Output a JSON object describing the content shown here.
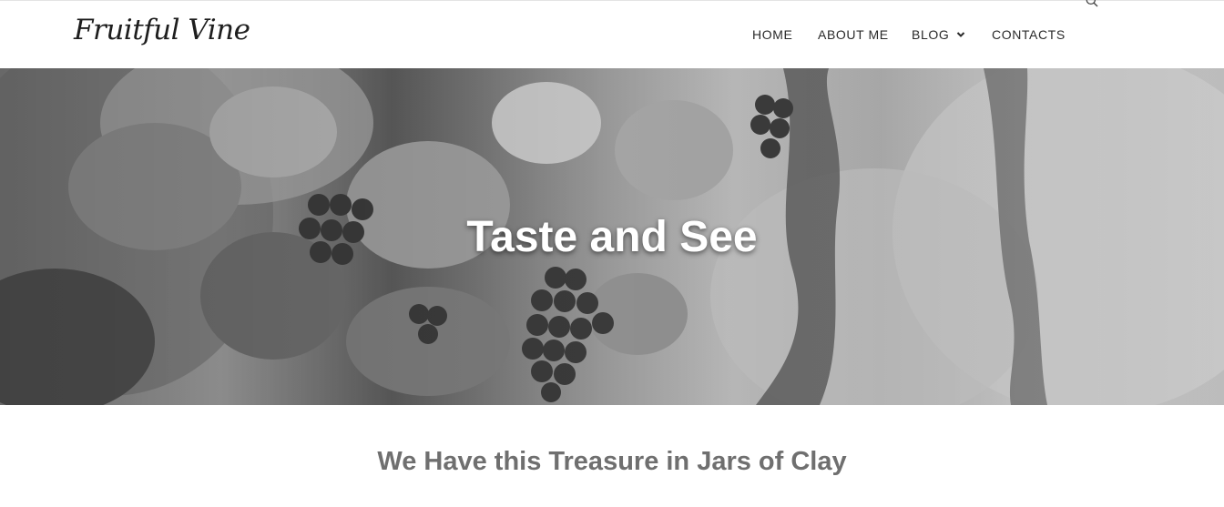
{
  "site": {
    "logo_text": "Fruitful Vine"
  },
  "nav": {
    "items": [
      {
        "label": "HOME"
      },
      {
        "label": "ABOUT ME"
      },
      {
        "label": "BLOG"
      },
      {
        "label": "CONTACTS"
      }
    ],
    "search_icon": "search-icon",
    "dropdown_icon": "chevron-down-icon"
  },
  "hero": {
    "title": "Taste and See",
    "image": "grayscale vineyard grapes"
  },
  "section": {
    "heading": "We Have this Treasure in Jars of Clay"
  },
  "colors": {
    "heading_gray": "#6f6f6f",
    "nav_text": "#2a2a2a",
    "hero_text": "#ffffff"
  }
}
